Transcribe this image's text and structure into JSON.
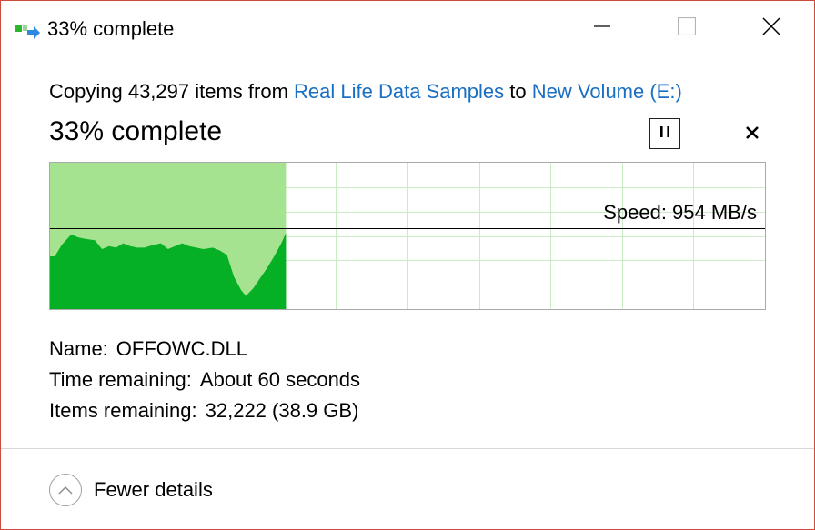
{
  "window": {
    "title": "33% complete",
    "title_bar_icons": [
      "copy-transfer-icon"
    ],
    "controls": [
      "minimize-icon",
      "maximize-icon",
      "close-icon"
    ],
    "border_color": "#d04a3c"
  },
  "copy": {
    "prefix": "Copying 43,297 items from ",
    "source": "Real Life Data Samples",
    "connector": " to ",
    "destination": "New Volume (E:)",
    "link_color": "#1a6fc4"
  },
  "progress": {
    "heading": "33% complete",
    "fraction": 0.33,
    "pause_icon": "pause-icon",
    "stop_icon": "stop-icon"
  },
  "speed": {
    "label": "Speed: 954 MB/s",
    "graph_fill_light": "#a6e391",
    "graph_fill_dark": "#06b025",
    "grid_color": "#c9ecc4"
  },
  "details": {
    "name_label": "Name:",
    "name_value": "OFFOWC.DLL",
    "time_label": "Time remaining:",
    "time_value": "About 60 seconds",
    "items_label": "Items remaining:",
    "items_value": "32,222 (38.9 GB)"
  },
  "footer": {
    "fewer_details": "Fewer details",
    "toggle_icon": "chevron-up-icon"
  }
}
